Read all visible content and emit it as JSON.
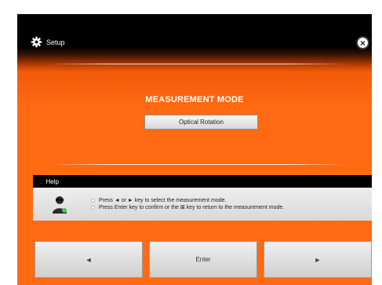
{
  "header": {
    "title": "Setup",
    "icon": "gear-icon",
    "close_icon": "close-icon"
  },
  "mode": {
    "title": "MEASUREMENT MODE",
    "selected_value": "Optical Rotation"
  },
  "help": {
    "title": "Help",
    "lines": [
      "Press ◄ or ► key to select the measurement mode.",
      "Press Enter key to confirm or the ⊠ key to return to the measurement mode."
    ]
  },
  "buttons": {
    "left": "◄",
    "enter": "Enter",
    "right": "►"
  },
  "colors": {
    "accent": "#ff6a12",
    "header_bg": "#000000"
  }
}
